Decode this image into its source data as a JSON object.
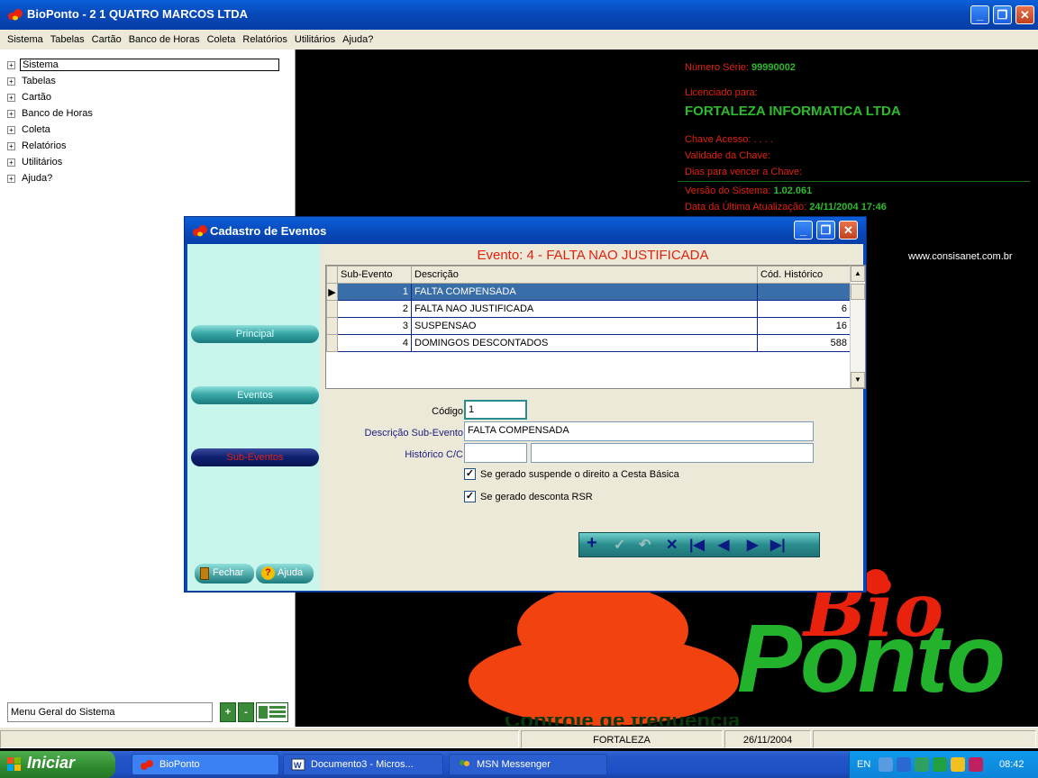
{
  "window": {
    "title": "BioPonto - 2 1 QUATRO MARCOS LTDA",
    "min": "_",
    "restore": "❐",
    "close": "✕"
  },
  "menu": [
    "Sistema",
    "Tabelas",
    "Cartão",
    "Banco de Horas",
    "Coleta",
    "Relatórios",
    "Utilitários",
    "Ajuda?"
  ],
  "tree": [
    "Sistema",
    "Tabelas",
    "Cartão",
    "Banco de Horas",
    "Coleta",
    "Relatórios",
    "Utilitários",
    "Ajuda?"
  ],
  "tree_expander": "+",
  "left_footer": {
    "field": "Menu Geral do Sistema",
    "btn_plus": "+",
    "btn_minus": "-"
  },
  "info": {
    "serie_label": "Número Série:",
    "serie_value": "99990002",
    "licenciado_label": "Licenciado para:",
    "licenciado_value": "FORTALEZA INFORMATICA LTDA",
    "chave_label": "Chave Acesso:",
    "chave_value": ". . . .",
    "validade_label": "Validade da Chave:",
    "dias_label": "Dias para vencer a Chave:",
    "versao_label": "Versão do Sistema:",
    "versao_value": "1.02.061",
    "atualizacao_label": "Data da Última Atualização:",
    "atualizacao_value": "24/11/2004 17:46",
    "website": "www.consisanet.com.br"
  },
  "logo": {
    "bio": "Bio",
    "ponto": "Ponto",
    "tagline": "Controle de frequência"
  },
  "statusbar": {
    "city": "FORTALEZA",
    "date": "26/11/2004"
  },
  "taskbar": {
    "start": "Iniciar",
    "tasks": [
      "BioPonto",
      "Documento3 - Micros...",
      "MSN Messenger"
    ],
    "lang": "EN",
    "time": "08:42"
  },
  "dialog": {
    "title": "Cadastro de Eventos",
    "evento_title": "Evento: 4 - FALTA NAO JUSTIFICADA",
    "nav": {
      "principal": "Principal",
      "eventos": "Eventos",
      "subeventos": "Sub-Eventos"
    },
    "fechar": "Fechar",
    "ajuda": "Ajuda",
    "ajuda_icon": "?",
    "grid": {
      "headers": [
        "Sub-Evento",
        "Descrição",
        "Cód. Histórico"
      ],
      "rows": [
        {
          "sub": "1",
          "desc": "FALTA COMPENSADA",
          "cod": ""
        },
        {
          "sub": "2",
          "desc": "FALTA NAO JUSTIFICADA",
          "cod": "6"
        },
        {
          "sub": "3",
          "desc": "SUSPENSAO",
          "cod": "16"
        },
        {
          "sub": "4",
          "desc": "DOMINGOS DESCONTADOS",
          "cod": "588"
        }
      ],
      "row_indicator": "▶",
      "scroll_up": "▲",
      "scroll_down": "▼"
    },
    "form": {
      "codigo_label": "Código",
      "codigo_value": "1",
      "descricao_label": "Descrição Sub-Evento",
      "descricao_value": "FALTA COMPENSADA",
      "historico_label": "Histórico C/C",
      "historico_value1": "",
      "historico_value2": "",
      "chk1_label": "Se gerado suspende o direito a Cesta Básica",
      "chk1_checked": true,
      "chk2_label": "Se gerado desconta RSR",
      "chk2_checked": true,
      "check_mark": "✓"
    },
    "navbar": {
      "add": "+",
      "post": "✓",
      "cancel": "↶",
      "delete": "✕",
      "first": "|◀",
      "prior": "◀",
      "next": "▶",
      "last": "▶|"
    }
  },
  "colors": {
    "xp_blue": "#0848b8",
    "info_red": "#e0220f",
    "info_green": "#2dbb2d",
    "logo_green": "#22b22c",
    "logo_red": "#f2420f",
    "teal": "#2a8c8e"
  }
}
